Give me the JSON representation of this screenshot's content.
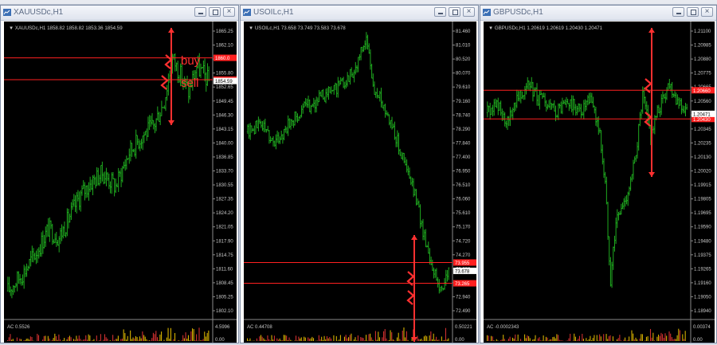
{
  "colors": {
    "plot_bg": "#000000",
    "candle": "#1faa1f",
    "grid": "#1a1a1a",
    "axis_text": "#c8c8c8",
    "level_line": "#ff2020",
    "marker": "#ff3030",
    "ac_up": "#d4b000",
    "ac_down": "#cf3030"
  },
  "icons": {
    "window": "chart-window-icon",
    "minimize": "minimize-icon",
    "maximize": "maximize-icon",
    "close": "close-icon"
  },
  "windows": [
    {
      "title": "XAUUSDc,H1",
      "header": "XAUUSDc,H1  1858.82 1858.82 1853.36 1854.59",
      "price_ticks": [
        "1865.25",
        "1862.10",
        "1858.95",
        "1855.80",
        "1852.65",
        "1849.45",
        "1846.30",
        "1843.15",
        "1840.00",
        "1836.85",
        "1833.70",
        "1830.55",
        "1827.35",
        "1824.20",
        "1821.05",
        "1817.90",
        "1814.75",
        "1811.60",
        "1808.45",
        "1805.25",
        "1802.10"
      ],
      "price_range": [
        1800.5,
        1867.0
      ],
      "level_lines": [
        {
          "price": 1860.0,
          "label": "1860.0"
        },
        {
          "price": 1854.9,
          "label": "1854.9"
        }
      ],
      "current_price": "1854.59",
      "annotations": [
        "buy",
        "sell"
      ],
      "indicator_label": "AC 0.5526",
      "indicator_ticks": [
        "4.5996",
        "0.00"
      ],
      "series": {
        "n": 150,
        "start": 1805.5,
        "points": [
          [
            0,
            1805.5
          ],
          [
            12,
            1810
          ],
          [
            22,
            1815
          ],
          [
            30,
            1820
          ],
          [
            38,
            1818
          ],
          [
            46,
            1823
          ],
          [
            54,
            1828
          ],
          [
            62,
            1831
          ],
          [
            70,
            1833
          ],
          [
            80,
            1830
          ],
          [
            90,
            1838
          ],
          [
            100,
            1842
          ],
          [
            108,
            1844
          ],
          [
            116,
            1850
          ],
          [
            122,
            1860
          ],
          [
            128,
            1856
          ],
          [
            134,
            1852
          ],
          [
            140,
            1858
          ],
          [
            149,
            1854.6
          ]
        ],
        "noise": 2.2
      }
    },
    {
      "title": "USOILc,H1",
      "header": "USOILc,H1  73.658 73.749 73.583 73.678",
      "price_ticks": [
        "81.460",
        "81.010",
        "80.520",
        "80.070",
        "79.610",
        "79.160",
        "78.740",
        "78.290",
        "77.840",
        "77.400",
        "76.950",
        "76.510",
        "76.060",
        "75.610",
        "75.170",
        "74.720",
        "74.270",
        "73.820",
        "73.380",
        "72.940",
        "72.490"
      ],
      "price_range": [
        72.3,
        81.75
      ],
      "level_lines": [
        {
          "price": 73.955,
          "label": "73.955"
        },
        {
          "price": 73.265,
          "label": "73.265"
        }
      ],
      "current_price": "73.678",
      "annotations": [],
      "indicator_label": "AC 0.44708",
      "indicator_ticks": [
        "0.50221",
        "0.00"
      ],
      "series": {
        "n": 150,
        "start": 78.3,
        "points": [
          [
            0,
            78.3
          ],
          [
            10,
            78.6
          ],
          [
            20,
            77.9
          ],
          [
            30,
            78.5
          ],
          [
            40,
            79.0
          ],
          [
            50,
            79.3
          ],
          [
            60,
            79.6
          ],
          [
            70,
            79.9
          ],
          [
            80,
            80.4
          ],
          [
            88,
            81.4
          ],
          [
            94,
            79.6
          ],
          [
            100,
            79.3
          ],
          [
            108,
            78.4
          ],
          [
            116,
            77.3
          ],
          [
            124,
            76.2
          ],
          [
            130,
            75.0
          ],
          [
            136,
            74.0
          ],
          [
            142,
            73.1
          ],
          [
            146,
            73.3
          ],
          [
            149,
            73.68
          ]
        ],
        "noise": 0.22
      }
    },
    {
      "title": "GBPUSDc,H1",
      "header": "GBPUSDc,H1  1.20619 1.20619 1.20430 1.20471",
      "price_ticks": [
        "1.21100",
        "1.20985",
        "1.20880",
        "1.20775",
        "1.20665",
        "1.20560",
        "1.20450",
        "1.20345",
        "1.20235",
        "1.20130",
        "1.20020",
        "1.19915",
        "1.19805",
        "1.19695",
        "1.19590",
        "1.19480",
        "1.19375",
        "1.19265",
        "1.19160",
        "1.19050",
        "1.18940"
      ],
      "price_range": [
        1.1888,
        1.2116
      ],
      "level_lines": [
        {
          "price": 1.2066,
          "label": "1.20660"
        },
        {
          "price": 1.2043,
          "label": "1.20430"
        }
      ],
      "current_price": "1.20471",
      "annotations": [],
      "indicator_label": "AC -0.0002343",
      "indicator_ticks": [
        "0.00374",
        "0.00"
      ],
      "series": {
        "n": 150,
        "start": 1.2048,
        "points": [
          [
            0,
            1.2048
          ],
          [
            8,
            1.2055
          ],
          [
            14,
            1.2035
          ],
          [
            22,
            1.2062
          ],
          [
            30,
            1.207
          ],
          [
            40,
            1.2058
          ],
          [
            50,
            1.2048
          ],
          [
            60,
            1.2055
          ],
          [
            70,
            1.2049
          ],
          [
            78,
            1.2058
          ],
          [
            84,
            1.203
          ],
          [
            88,
            1.199
          ],
          [
            92,
            1.1915
          ],
          [
            96,
            1.196
          ],
          [
            102,
            1.1975
          ],
          [
            108,
            1.1995
          ],
          [
            112,
            1.2025
          ],
          [
            116,
            1.206
          ],
          [
            122,
            1.203
          ],
          [
            128,
            1.205
          ],
          [
            136,
            1.2072
          ],
          [
            142,
            1.2058
          ],
          [
            149,
            1.2047
          ]
        ],
        "noise": 0.0006
      }
    }
  ]
}
